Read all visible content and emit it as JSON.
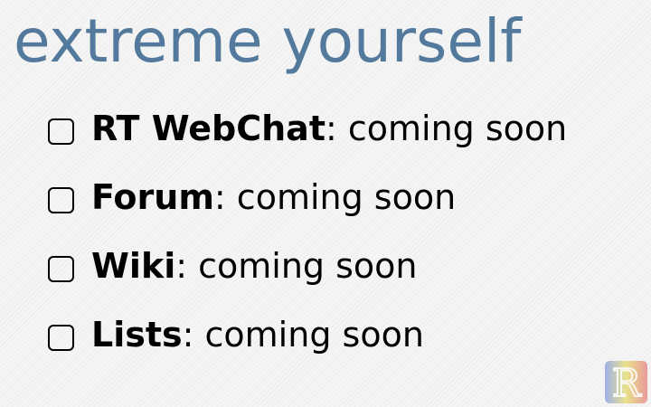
{
  "heading": "extreme yourself",
  "items": [
    {
      "name": "RT WebChat",
      "status": ": coming soon",
      "checked": false
    },
    {
      "name": "Forum",
      "status": ": coming soon",
      "checked": false
    },
    {
      "name": "Wiki",
      "status": ": coming soon",
      "checked": false
    },
    {
      "name": "Lists",
      "status": ": coming soon",
      "checked": false
    }
  ],
  "logo": {
    "letter": "R",
    "colors": [
      "#8fa6e8",
      "#e8e07a",
      "#e88a8a"
    ]
  },
  "colors": {
    "heading": "#537a9c",
    "text": "#000000",
    "background": "#f2f2f2"
  }
}
